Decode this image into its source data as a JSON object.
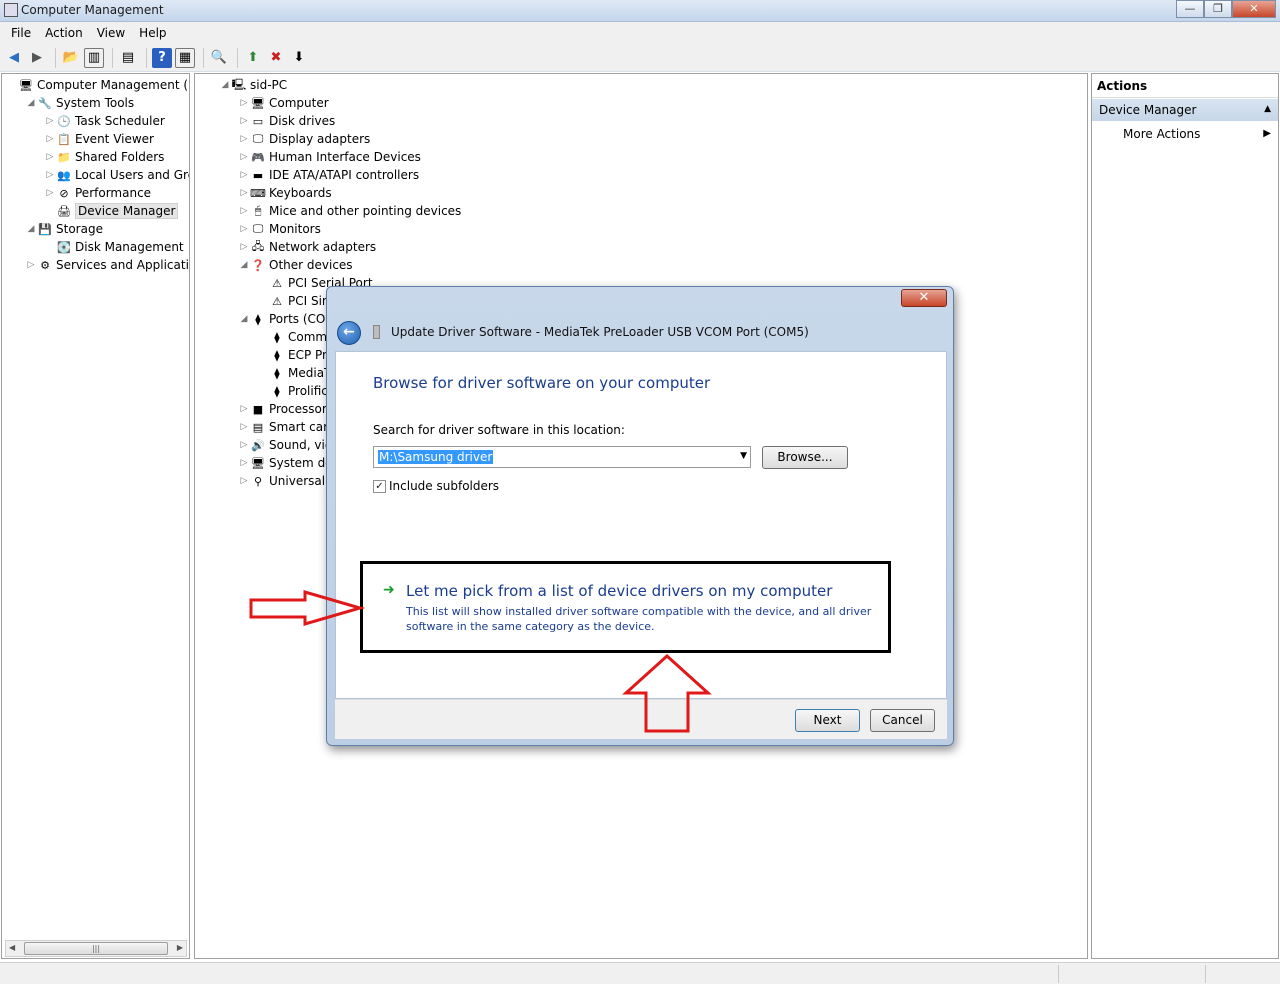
{
  "window": {
    "title": "Computer Management"
  },
  "menu": [
    "File",
    "Action",
    "View",
    "Help"
  ],
  "left_tree": [
    {
      "label": "Computer Management (Local",
      "indent": 0,
      "expander": "",
      "icon": "computer-management-icon",
      "glyph": "🖥"
    },
    {
      "label": "System Tools",
      "indent": 1,
      "expander": "◢",
      "icon": "tools-icon",
      "glyph": "🔧"
    },
    {
      "label": "Task Scheduler",
      "indent": 2,
      "expander": "▷",
      "icon": "clock-icon",
      "glyph": "🕒"
    },
    {
      "label": "Event Viewer",
      "indent": 2,
      "expander": "▷",
      "icon": "event-viewer-icon",
      "glyph": "📋"
    },
    {
      "label": "Shared Folders",
      "indent": 2,
      "expander": "▷",
      "icon": "shared-folder-icon",
      "glyph": "📁"
    },
    {
      "label": "Local Users and Groups",
      "indent": 2,
      "expander": "▷",
      "icon": "users-icon",
      "glyph": "👥"
    },
    {
      "label": "Performance",
      "indent": 2,
      "expander": "▷",
      "icon": "performance-icon",
      "glyph": "⊘"
    },
    {
      "label": "Device Manager",
      "indent": 2,
      "expander": "",
      "icon": "device-manager-icon",
      "glyph": "🖨",
      "selected": true
    },
    {
      "label": "Storage",
      "indent": 1,
      "expander": "◢",
      "icon": "storage-icon",
      "glyph": "💾"
    },
    {
      "label": "Disk Management",
      "indent": 2,
      "expander": "",
      "icon": "disk-icon",
      "glyph": "💽"
    },
    {
      "label": "Services and Applications",
      "indent": 1,
      "expander": "▷",
      "icon": "services-icon",
      "glyph": "⚙"
    }
  ],
  "device_tree": [
    {
      "label": "sid-PC",
      "indent": 0,
      "expander": "◢",
      "icon": "pc-icon",
      "glyph": "🖳"
    },
    {
      "label": "Computer",
      "indent": 1,
      "expander": "▷",
      "icon": "computer-icon",
      "glyph": "🖥"
    },
    {
      "label": "Disk drives",
      "indent": 1,
      "expander": "▷",
      "icon": "disk-drive-icon",
      "glyph": "▭"
    },
    {
      "label": "Display adapters",
      "indent": 1,
      "expander": "▷",
      "icon": "display-adapter-icon",
      "glyph": "🖵"
    },
    {
      "label": "Human Interface Devices",
      "indent": 1,
      "expander": "▷",
      "icon": "hid-icon",
      "glyph": "🎮"
    },
    {
      "label": "IDE ATA/ATAPI controllers",
      "indent": 1,
      "expander": "▷",
      "icon": "ide-icon",
      "glyph": "▬"
    },
    {
      "label": "Keyboards",
      "indent": 1,
      "expander": "▷",
      "icon": "keyboard-icon",
      "glyph": "⌨"
    },
    {
      "label": "Mice and other pointing devices",
      "indent": 1,
      "expander": "▷",
      "icon": "mouse-icon",
      "glyph": "🖱"
    },
    {
      "label": "Monitors",
      "indent": 1,
      "expander": "▷",
      "icon": "monitor-icon",
      "glyph": "🖵"
    },
    {
      "label": "Network adapters",
      "indent": 1,
      "expander": "▷",
      "icon": "network-icon",
      "glyph": "🖧"
    },
    {
      "label": "Other devices",
      "indent": 1,
      "expander": "◢",
      "icon": "other-devices-icon",
      "glyph": "❓"
    },
    {
      "label": "PCI Serial Port",
      "indent": 2,
      "expander": "",
      "icon": "warning-device-icon",
      "glyph": "⚠"
    },
    {
      "label": "PCI Simp",
      "indent": 2,
      "expander": "",
      "icon": "warning-device-icon",
      "glyph": "⚠"
    },
    {
      "label": "Ports (COM &",
      "indent": 1,
      "expander": "◢",
      "icon": "port-icon",
      "glyph": "⧫"
    },
    {
      "label": "Commun",
      "indent": 2,
      "expander": "",
      "icon": "port-icon",
      "glyph": "⧫"
    },
    {
      "label": "ECP Print",
      "indent": 2,
      "expander": "",
      "icon": "port-icon",
      "glyph": "⧫"
    },
    {
      "label": "MediaTek",
      "indent": 2,
      "expander": "",
      "icon": "port-icon",
      "glyph": "⧫"
    },
    {
      "label": "Prolific U",
      "indent": 2,
      "expander": "",
      "icon": "port-icon",
      "glyph": "⧫"
    },
    {
      "label": "Processors",
      "indent": 1,
      "expander": "▷",
      "icon": "processor-icon",
      "glyph": "■"
    },
    {
      "label": "Smart card re",
      "indent": 1,
      "expander": "▷",
      "icon": "smart-card-icon",
      "glyph": "▤"
    },
    {
      "label": "Sound, video",
      "indent": 1,
      "expander": "▷",
      "icon": "sound-icon",
      "glyph": "🔊"
    },
    {
      "label": "System devic",
      "indent": 1,
      "expander": "▷",
      "icon": "system-device-icon",
      "glyph": "🖥"
    },
    {
      "label": "Universal Seri",
      "indent": 1,
      "expander": "▷",
      "icon": "usb-icon",
      "glyph": "⚲"
    }
  ],
  "actions": {
    "header": "Actions",
    "section": "Device Manager",
    "item": "More Actions"
  },
  "dialog": {
    "title": "Update Driver Software - MediaTek PreLoader USB VCOM Port (COM5)",
    "heading": "Browse for driver software on your computer",
    "search_label": "Search for driver software in this location:",
    "path_value": "M:\\Samsung driver",
    "browse_label": "Browse...",
    "include_subfolders_label": "Include subfolders",
    "include_subfolders_checked": true,
    "option_title": "Let me pick from a list of device drivers on my computer",
    "option_desc": "This list will show installed driver software compatible with the device, and all driver software in the same category as the device.",
    "next_label": "Next",
    "cancel_label": "Cancel"
  },
  "colors": {
    "link_blue": "#1a3d8f",
    "annotation_red": "#e01818",
    "selection_blue": "#3399ff"
  }
}
